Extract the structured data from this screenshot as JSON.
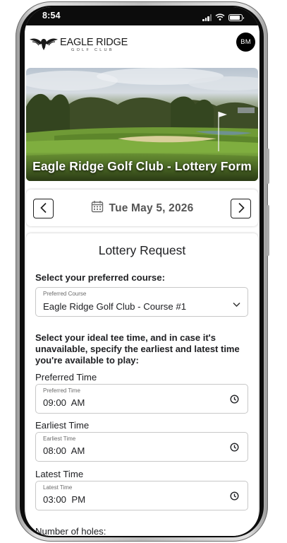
{
  "status_bar": {
    "time": "8:54"
  },
  "header": {
    "logo_main": "EAGLE RIDGE",
    "logo_sub": "GOLF CLUB",
    "avatar_initials": "BM"
  },
  "hero": {
    "title": "Eagle Ridge Golf Club - Lottery Form"
  },
  "date_nav": {
    "date": "Tue May 5, 2026",
    "prev_icon": "chevron-left-icon",
    "next_icon": "chevron-right-icon",
    "calendar_icon": "calendar-icon"
  },
  "form": {
    "title": "Lottery Request",
    "course_prompt": "Select your preferred course:",
    "course_field": {
      "label": "Preferred Course",
      "value": "Eagle Ridge Golf Club - Course #1"
    },
    "instructions": "Select your ideal tee time, and in case it's unavailable, specify the earliest and latest time you're available to play:",
    "preferred_time": {
      "heading": "Preferred Time",
      "label": "Preferred Time",
      "value": "09:00  AM"
    },
    "earliest_time": {
      "heading": "Earliest Time",
      "label": "Earliest Time",
      "value": "08:00  AM"
    },
    "latest_time": {
      "heading": "Latest Time",
      "label": "Latest Time",
      "value": "03:00  PM"
    },
    "holes_heading": "Number of holes:"
  }
}
